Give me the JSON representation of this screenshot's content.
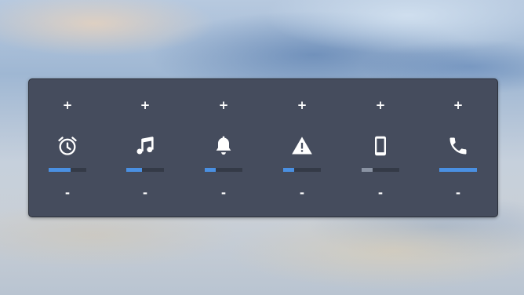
{
  "mixer": {
    "increase_label": "+",
    "decrease_label": "-",
    "channels": [
      {
        "name": "alarm",
        "icon": "alarm-clock-icon",
        "level": 0.58,
        "color": "#4a90e2"
      },
      {
        "name": "media",
        "icon": "music-note-icon",
        "level": 0.42,
        "color": "#4a90e2"
      },
      {
        "name": "notification",
        "icon": "bell-icon",
        "level": 0.3,
        "color": "#4a90e2"
      },
      {
        "name": "alert",
        "icon": "warning-icon",
        "level": 0.3,
        "color": "#4a90e2"
      },
      {
        "name": "system",
        "icon": "phone-device-icon",
        "level": 0.3,
        "color": "#8a93a3"
      },
      {
        "name": "call",
        "icon": "phone-call-icon",
        "level": 1.0,
        "color": "#4a90e2"
      }
    ]
  }
}
